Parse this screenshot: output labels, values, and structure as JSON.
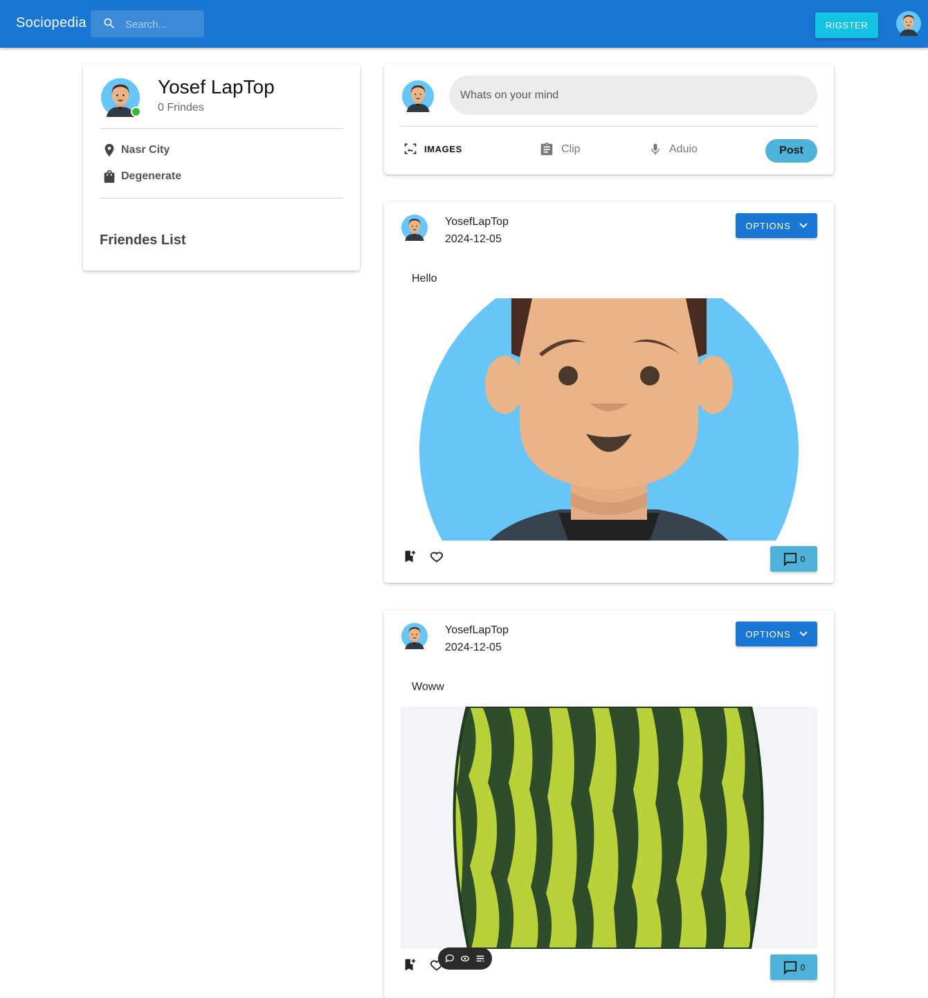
{
  "appbar": {
    "brand": "Sociopedia",
    "search_placeholder": "Search...",
    "register_label": "RIGSTER"
  },
  "profile": {
    "name": "Yosef LapTop",
    "friends": "0 Frindes",
    "location": "Nasr City",
    "occupation": "Degenerate",
    "friends_list_title": "Friendes List"
  },
  "composer": {
    "placeholder": "Whats on your mind",
    "images_label": "IMAGES",
    "clip_label": "Clip",
    "audio_label": "Aduio",
    "post_label": "Post"
  },
  "posts": [
    {
      "user": "YosefLapTop",
      "date": "2024-12-05",
      "options_label": "OPTIONS",
      "text": "Hello",
      "image": "avatar-illustration",
      "comments": "0"
    },
    {
      "user": "YosefLapTop",
      "date": "2024-12-05",
      "options_label": "OPTIONS",
      "text": "Woww",
      "image": "watermelon-photo",
      "comments": "0"
    }
  ],
  "colors": {
    "appbar": "#1976d2",
    "register": "#12c3e3",
    "accent": "#4fb3d9",
    "online": "#3ab53a"
  }
}
